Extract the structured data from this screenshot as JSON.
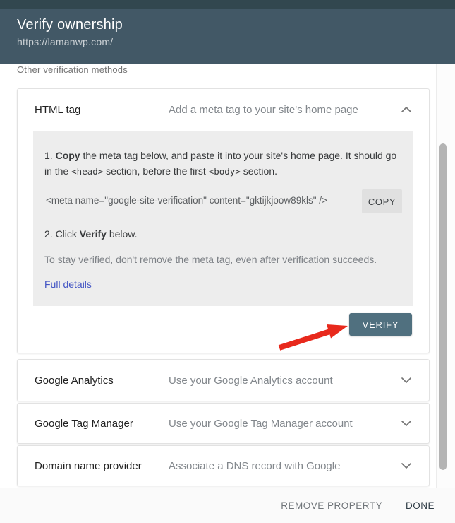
{
  "header": {
    "title": "Verify ownership",
    "subtitle": "https://lamanwp.com/"
  },
  "section_label": "Other verification methods",
  "html_tag": {
    "label": "HTML tag",
    "description": "Add a meta tag to your site's home page",
    "step1": {
      "prefix": "1. ",
      "bold": "Copy",
      "text_a": " the meta tag below, and paste it into your site's home page. It should go in the ",
      "code_head": "<head>",
      "text_b": " section, before the first ",
      "code_body": "<body>",
      "text_c": " section."
    },
    "meta_tag": "<meta name=\"google-site-verification\" content=\"gktijkjoow89kls\" />",
    "copy_label": "COPY",
    "step2": {
      "prefix": "2. Click ",
      "bold": "Verify",
      "suffix": " below."
    },
    "note": "To stay verified, don't remove the meta tag, even after verification succeeds.",
    "link_label": "Full details",
    "verify_label": "VERIFY"
  },
  "methods": [
    {
      "label": "Google Analytics",
      "description": "Use your Google Analytics account"
    },
    {
      "label": "Google Tag Manager",
      "description": "Use your Google Tag Manager account"
    },
    {
      "label": "Domain name provider",
      "description": "Associate a DNS record with Google"
    }
  ],
  "footer": {
    "remove_label": "REMOVE PROPERTY",
    "done_label": "DONE"
  },
  "icons": {
    "html_tag_state": "chevron-up",
    "collapsed_state": "chevron-down",
    "annotation": "red-arrow-pointing-to-verify"
  },
  "colors": {
    "header_bg": "#425866",
    "header_top_strip": "#32474f",
    "verify_button_bg": "#50707f",
    "panel_bg": "#ededed",
    "link_color": "#4355c4",
    "arrow_color": "#e8291c",
    "muted_text": "#82878c",
    "done_text": "#2e3b45"
  }
}
